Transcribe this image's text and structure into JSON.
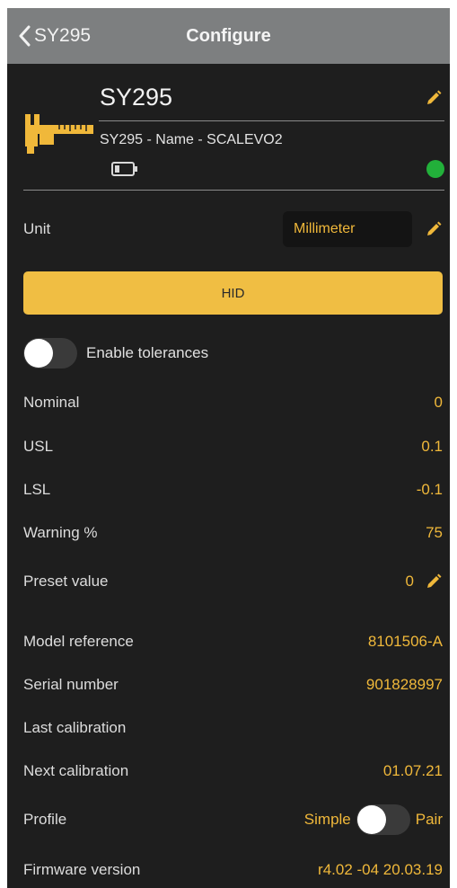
{
  "nav": {
    "back_label": "SY295",
    "title": "Configure"
  },
  "device": {
    "name": "SY295",
    "subtitle": "SY295 - Name - SCALEVO2"
  },
  "unit": {
    "label": "Unit",
    "value": "Millimeter"
  },
  "hid_button": {
    "label": "HID"
  },
  "tolerances": {
    "label": "Enable tolerances",
    "enabled": false
  },
  "fields": [
    {
      "label": "Nominal",
      "value": "0"
    },
    {
      "label": "USL",
      "value": "0.1"
    },
    {
      "label": "LSL",
      "value": "-0.1"
    },
    {
      "label": "Warning %",
      "value": "75"
    },
    {
      "label": "Preset value",
      "value": "0"
    },
    {
      "label": "Model reference",
      "value": "8101506-A"
    },
    {
      "label": "Serial number",
      "value": "901828997"
    },
    {
      "label": "Last calibration",
      "value": ""
    },
    {
      "label": "Next calibration",
      "value": "01.07.21"
    }
  ],
  "profile": {
    "label": "Profile",
    "left_option": "Simple",
    "right_option": "Pair"
  },
  "firmware": {
    "label": "Firmware version",
    "value": "r4.02 -04 20.03.19"
  },
  "colors": {
    "accent": "#f0b83a",
    "background": "#1e1e1e",
    "navbar": "#7d7f80",
    "status_connected": "#22b03a"
  },
  "icons": {
    "back": "chevron-left-icon",
    "edit": "pencil-icon",
    "battery": "battery-icon",
    "device": "caliper-icon"
  }
}
